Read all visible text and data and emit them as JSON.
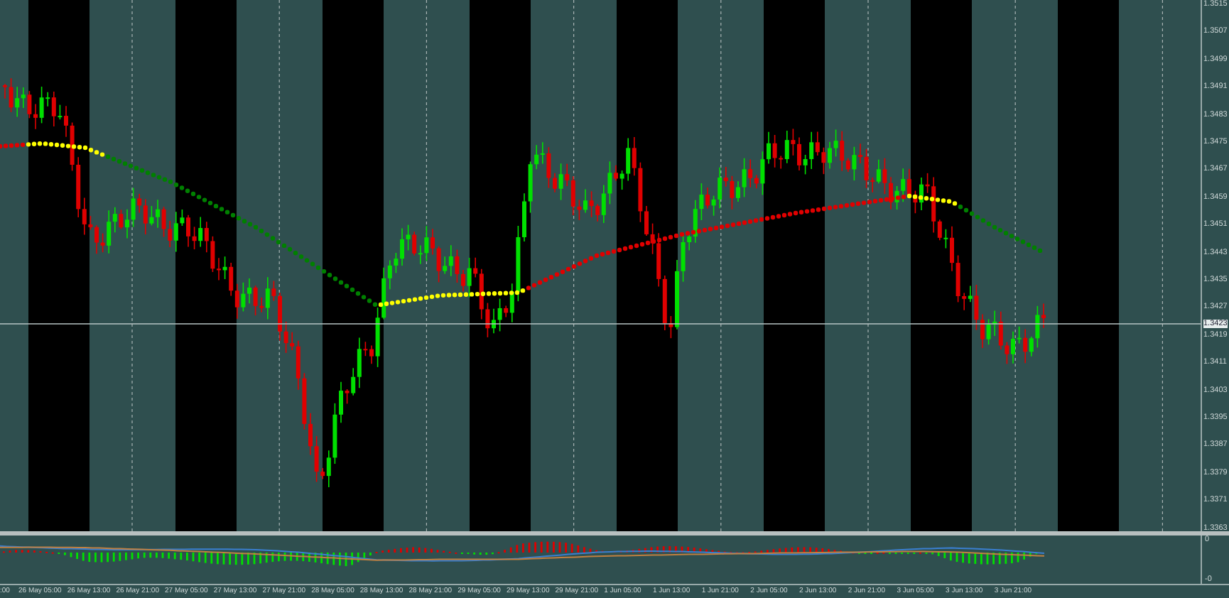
{
  "price_axis": {
    "labels": [
      "1.3515",
      "1.3507",
      "1.3499",
      "1.3491",
      "1.3483",
      "1.3475",
      "1.3467",
      "1.3459",
      "1.3451",
      "1.3443",
      "1.3435",
      "1.3427",
      "1.3419",
      "1.3411",
      "1.3403",
      "1.3395",
      "1.3387",
      "1.3379",
      "1.3371",
      "1.3363"
    ],
    "current_price": "1.3423"
  },
  "indicator_axis": {
    "labels": [
      "0",
      "-0"
    ]
  },
  "time_axis": {
    "labels": [
      ":00",
      "26 May 05:00",
      "26 May 13:00",
      "26 May 21:00",
      "27 May 05:00",
      "27 May 13:00",
      "27 May 21:00",
      "28 May 05:00",
      "28 May 13:00",
      "28 May 21:00",
      "29 May 05:00",
      "29 May 13:00",
      "29 May 21:00",
      "1 Jun 05:00",
      "1 Jun 13:00",
      "1 Jun 21:00",
      "2 Jun 05:00",
      "2 Jun 13:00",
      "2 Jun 21:00",
      "3 Jun 05:00",
      "3 Jun 13:00",
      "3 Jun 21:00"
    ]
  }
}
